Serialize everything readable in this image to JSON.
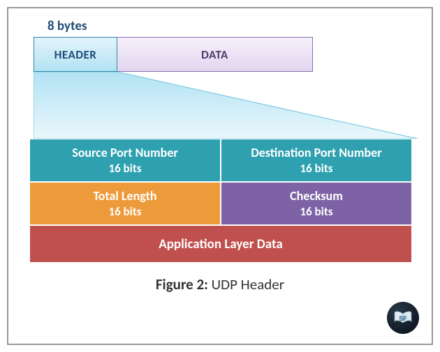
{
  "top_label": "8 bytes",
  "packet": {
    "header_label": "HEADER",
    "data_label": "DATA"
  },
  "fields": {
    "src_port": {
      "name": "Source Port Number",
      "bits": "16 bits"
    },
    "dst_port": {
      "name": "Destination Port Number",
      "bits": "16 bits"
    },
    "total_len": {
      "name": "Total Length",
      "bits": "16 bits"
    },
    "checksum": {
      "name": "Checksum",
      "bits": "16 bits"
    },
    "app_data": "Application Layer Data"
  },
  "caption": {
    "prefix": "Figure 2:",
    "text": "  UDP Header"
  },
  "logo_text": "SF"
}
